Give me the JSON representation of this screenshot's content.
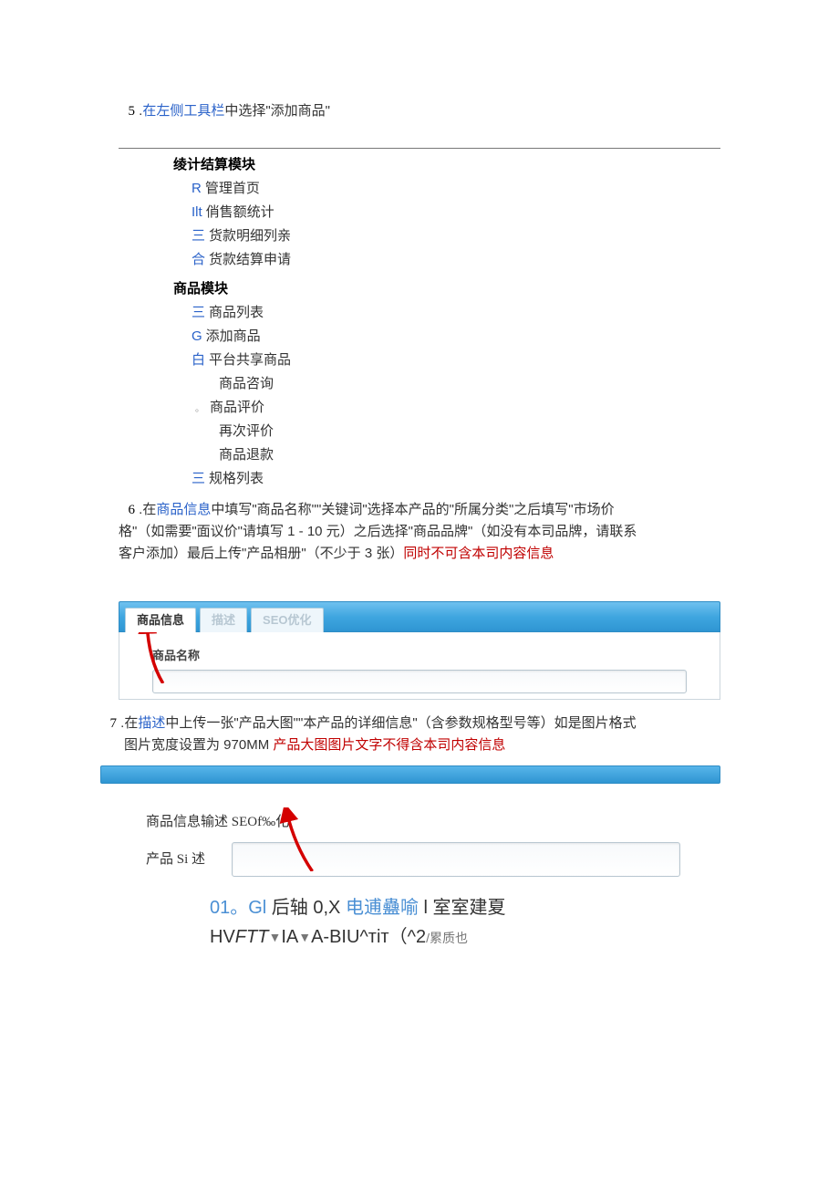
{
  "step5": {
    "num": "5",
    "dot": " .",
    "link": "在左侧工具栏",
    "rest": "中选择\"添加商品\""
  },
  "sidebar": {
    "group1": {
      "title": "绫计结算模块",
      "items": [
        {
          "mark": "R",
          "label": "管理首页"
        },
        {
          "mark": "Ilt",
          "label": "俏售额统计"
        },
        {
          "mark": "三",
          "label": "货款明细列亲"
        },
        {
          "mark": "合",
          "label": "货款结算申请"
        }
      ]
    },
    "group2": {
      "title": "商品模块",
      "items": [
        {
          "mark": "三",
          "label": "商品列表"
        },
        {
          "mark": "G",
          "label": "添加商品"
        },
        {
          "mark": "白",
          "label": "平台共享商品"
        }
      ],
      "subitems": [
        {
          "mark": "",
          "label": "商品咨询"
        },
        {
          "mark": "。",
          "label": "商品评价"
        },
        {
          "mark": "",
          "label": "再次评价"
        },
        {
          "mark": "",
          "label": "商品退款"
        }
      ],
      "tail": {
        "mark": "三",
        "label": "规格列表"
      }
    }
  },
  "step6": {
    "num": "6",
    "dot": " .在",
    "link": "商品信息",
    "line1_a": "中填写\"商品名称\"\"关键词\"选择本产品的\"所属分类\"之后填写\"市场价",
    "line2_a": "格\"（如需要\"面议价\"请填写 1 - 10 元）之后选择\"商品品牌\"（如没有本司品牌，请联系",
    "line3_a": "客户添加）最后上传\"产品相册\"（不少于 3 张）",
    "line3_red": "同时不可含本司内容信息"
  },
  "ui_tabs": {
    "tab1": "商品信息",
    "tab2": "描述",
    "tab3": "SEO优化",
    "form_label": "商品名称"
  },
  "step7": {
    "num": "7",
    "dot": " .在",
    "link": "描述",
    "line1_a": "中上传一张\"产品大图\"\"本产品的详细信息\"（含参数规格型号等）如是图片格式",
    "line2_a": "图片宽度设置为 970MM ",
    "line2_red": "产品大图图片文字不得含本司内容信息"
  },
  "editor_tabs_row": "商品信息输述 SEOf‰化",
  "editor_label": "产品 Si 述",
  "toolbar": {
    "row1_blue_a": "01。Gl",
    "row1_black_a": " 后轴 0,X ",
    "row1_blue_b": "电逋蠱喻",
    "row1_black_b": " l 室室建夏",
    "row2_a": "HV",
    "row2_i": "FTT",
    "row2_b": "IA",
    "row2_c": "A-B",
    "row2_d": "IU^тiт",
    "row2_e": "（^2",
    "row2_f": "/累质也"
  }
}
